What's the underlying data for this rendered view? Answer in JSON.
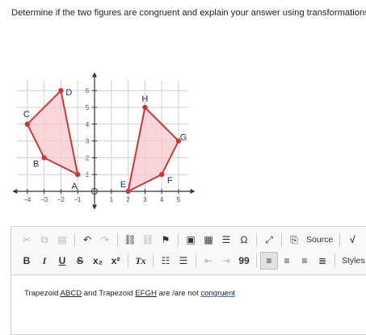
{
  "question": "Determine if the two figures are congruent and explain your answer using transformations.",
  "graph": {
    "x_ticks": [
      "-4",
      "-3",
      "-2",
      "-1",
      "1",
      "2",
      "3",
      "4",
      "5"
    ],
    "y_ticks": [
      "1",
      "2",
      "3",
      "4",
      "5",
      "6"
    ],
    "points": [
      {
        "label": "A",
        "x": -1,
        "y": 1
      },
      {
        "label": "B",
        "x": -3,
        "y": 2
      },
      {
        "label": "C",
        "x": -4,
        "y": 4
      },
      {
        "label": "D",
        "x": -2,
        "y": 6
      },
      {
        "label": "E",
        "x": 2,
        "y": 0
      },
      {
        "label": "F",
        "x": 4,
        "y": 1
      },
      {
        "label": "G",
        "x": 5,
        "y": 3
      },
      {
        "label": "H",
        "x": 3,
        "y": 5
      }
    ],
    "shape_color": "#c83a3a",
    "fill_color": "#f5c8cc"
  },
  "toolbar": {
    "source_label": "Source",
    "styles_label": "Styles",
    "bold": "B",
    "italic": "I",
    "underline": "U",
    "strike": "S",
    "subscript": "x₂",
    "superscript": "x²",
    "remove_format": "Tx",
    "blockquote": "99",
    "special_char": "Ω"
  },
  "editor": {
    "text_1": "Trapezoid ",
    "abcd": "ABCD",
    "text_2": " and Trapezoid ",
    "efgh": "EFGH",
    "text_3": "  are /are not ",
    "congruent": "congruent"
  }
}
